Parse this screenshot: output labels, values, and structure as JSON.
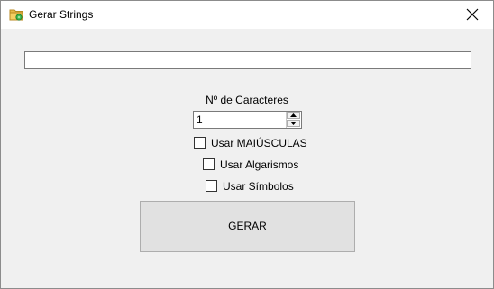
{
  "window": {
    "title": "Gerar Strings",
    "app_icon": "folder-icon",
    "close_icon": "close-icon"
  },
  "output": {
    "value": ""
  },
  "length": {
    "label": "Nº de Caracteres",
    "value": "1"
  },
  "options": {
    "uppercase": {
      "label": "Usar MAIÚSCULAS",
      "checked": false
    },
    "digits": {
      "label": "Usar Algarismos",
      "checked": false
    },
    "symbols": {
      "label": "Usar Símbolos",
      "checked": false
    }
  },
  "generate_button": {
    "label": "GERAR"
  },
  "colors": {
    "window_bg": "#f0f0f0",
    "titlebar_bg": "#ffffff",
    "button_bg": "#e1e1e1",
    "border": "#7a7a7a"
  }
}
